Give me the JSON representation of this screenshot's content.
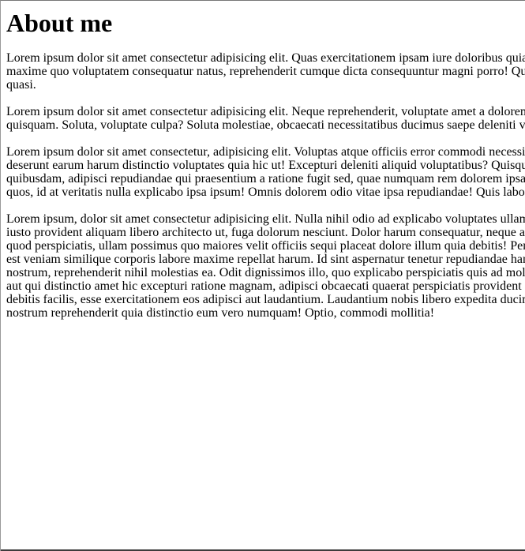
{
  "page": {
    "title": "About me",
    "paragraphs": [
      {
        "lines": [
          "Lorem ipsum dolor sit amet consectetur adipisicing elit. Quas exercitationem ipsam iure doloribus quia",
          "maxime quo voluptatem consequatur natus, reprehenderit cumque dicta consequuntur magni porro! Quia",
          "quasi."
        ]
      },
      {
        "lines": [
          "Lorem ipsum dolor sit amet consectetur adipisicing elit. Neque reprehenderit, voluptate amet a doloremque",
          "quisquam. Soluta, voluptate culpa? Soluta molestiae, obcaecati necessitatibus ducimus saepe deleniti vel"
        ]
      },
      {
        "lines": [
          "Lorem ipsum dolor sit amet consectetur, adipisicing elit. Voluptas atque officiis error commodi necessitatibus",
          "deserunt earum harum distinctio voluptates quia hic ut! Excepturi deleniti aliquid voluptatibus? Quisquam",
          "quibusdam, adipisci repudiandae qui praesentium a ratione fugit sed, quae numquam rem dolorem ipsam",
          "quos, id at veritatis nulla explicabo ipsa ipsum! Omnis dolorem odio vitae ipsa repudiandae! Quis laboriosam"
        ]
      },
      {
        "lines": [
          "Lorem ipsum, dolor sit amet consectetur adipisicing elit. Nulla nihil odio ad explicabo voluptates ullam",
          "iusto provident aliquam libero architecto ut, fuga dolorum nesciunt. Dolor harum consequatur, neque aut",
          "quod perspiciatis, ullam possimus quo maiores velit officiis sequi placeat dolore illum quia debitis! Perferendis",
          "est veniam similique corporis labore maxime repellat harum. Id sint aspernatur tenetur repudiandae harum",
          "nostrum, reprehenderit nihil molestias ea. Odit dignissimos illo, quo explicabo perspiciatis quis ad molestiae",
          "aut qui distinctio amet hic excepturi ratione magnam, adipisci obcaecati quaerat perspiciatis provident",
          "debitis facilis, esse exercitationem eos adipisci aut laudantium. Laudantium nobis libero expedita ducimus",
          "nostrum reprehenderit quia distinctio eum vero numquam! Optio, commodi mollitia!"
        ]
      }
    ]
  }
}
